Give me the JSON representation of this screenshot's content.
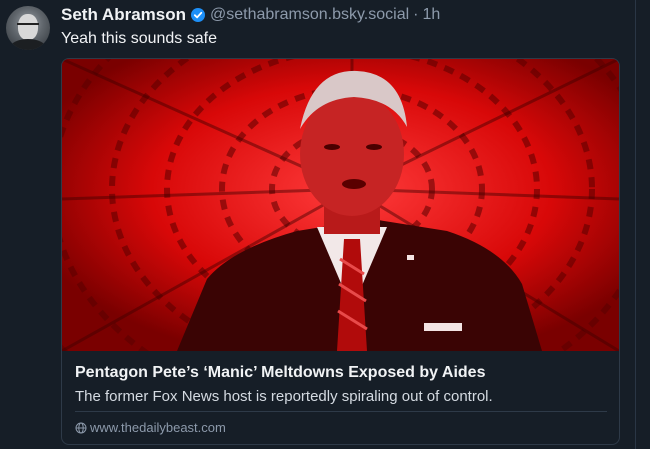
{
  "post": {
    "author_name": "Seth Abramson",
    "handle": "@sethabramson.bsky.social",
    "separator": "·",
    "time": "1h",
    "text": "Yeah this sounds safe"
  },
  "card": {
    "title": "Pentagon Pete’s ‘Manic’ Meltdowns Exposed by Aides",
    "description": "The former Fox News host is reportedly spiraling out of control.",
    "domain": "www.thedailybeast.com",
    "image_icon": "man-in-suit-red-spiral-photo"
  },
  "icons": {
    "verified": "verified-badge-icon",
    "globe": "globe-icon"
  },
  "colors": {
    "background": "#161e27",
    "text_primary": "#f1f3f5",
    "text_secondary": "#8d9aab",
    "verified_blue": "#1d8ff7",
    "image_red": "#e20c0c"
  }
}
